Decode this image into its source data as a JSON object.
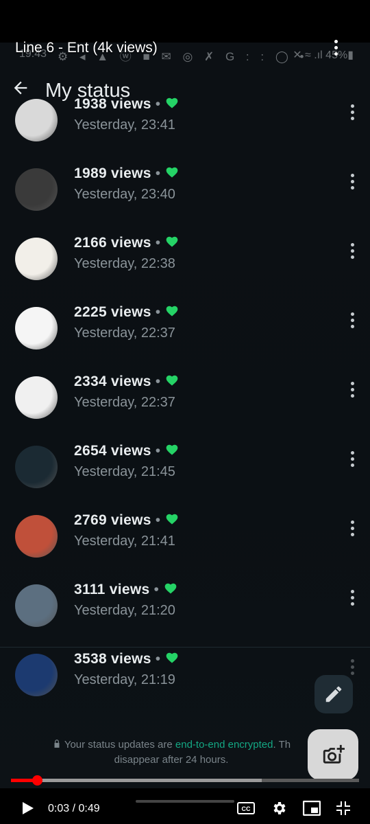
{
  "video_title": "Line 6 - Ent (4k views)",
  "phone_status": {
    "time": "19:43",
    "notification_icons": "⚙ ◂ ▲ ⓦ ■ ✉ ◎ ✗ G : : ◯ •",
    "battery_text": "✕ ≈ .ıl 45%▮"
  },
  "app": {
    "title": "My status"
  },
  "statuses": [
    {
      "views": "1938 views",
      "time": "Yesterday, 23:41",
      "thumb_color": "#d9d9d9"
    },
    {
      "views": "1989 views",
      "time": "Yesterday, 23:40",
      "thumb_color": "#3a3a3a"
    },
    {
      "views": "2166 views",
      "time": "Yesterday, 22:38",
      "thumb_color": "#f2efe9"
    },
    {
      "views": "2225 views",
      "time": "Yesterday, 22:37",
      "thumb_color": "#f5f5f5"
    },
    {
      "views": "2334 views",
      "time": "Yesterday, 22:37",
      "thumb_color": "#f0f0f0"
    },
    {
      "views": "2654 views",
      "time": "Yesterday, 21:45",
      "thumb_color": "#1b2a33"
    },
    {
      "views": "2769 views",
      "time": "Yesterday, 21:41",
      "thumb_color": "#c0503a"
    },
    {
      "views": "3111 views",
      "time": "Yesterday, 21:20",
      "thumb_color": "#5c6f80"
    },
    {
      "views": "3538 views",
      "time": "Yesterday, 21:19",
      "thumb_color": "#1c3a70"
    }
  ],
  "footer": {
    "prefix": "Your status updates are ",
    "link": "end-to-end encrypted",
    "suffix": ". Th",
    "line2": "disappear after 24 hours."
  },
  "player": {
    "timecode": "0:03 / 0:49",
    "played_fraction": 0.075,
    "buffered_fraction": 0.72
  },
  "colors": {
    "accent_green": "#25d366",
    "progress_red": "#ff0000"
  },
  "icons": [
    "back-arrow-icon",
    "heart-icon",
    "more-vert-icon",
    "pencil-icon",
    "camera-plus-icon",
    "lock-icon",
    "play-icon",
    "cc-icon",
    "gear-icon",
    "miniplayer-icon",
    "exit-fullscreen-icon"
  ]
}
